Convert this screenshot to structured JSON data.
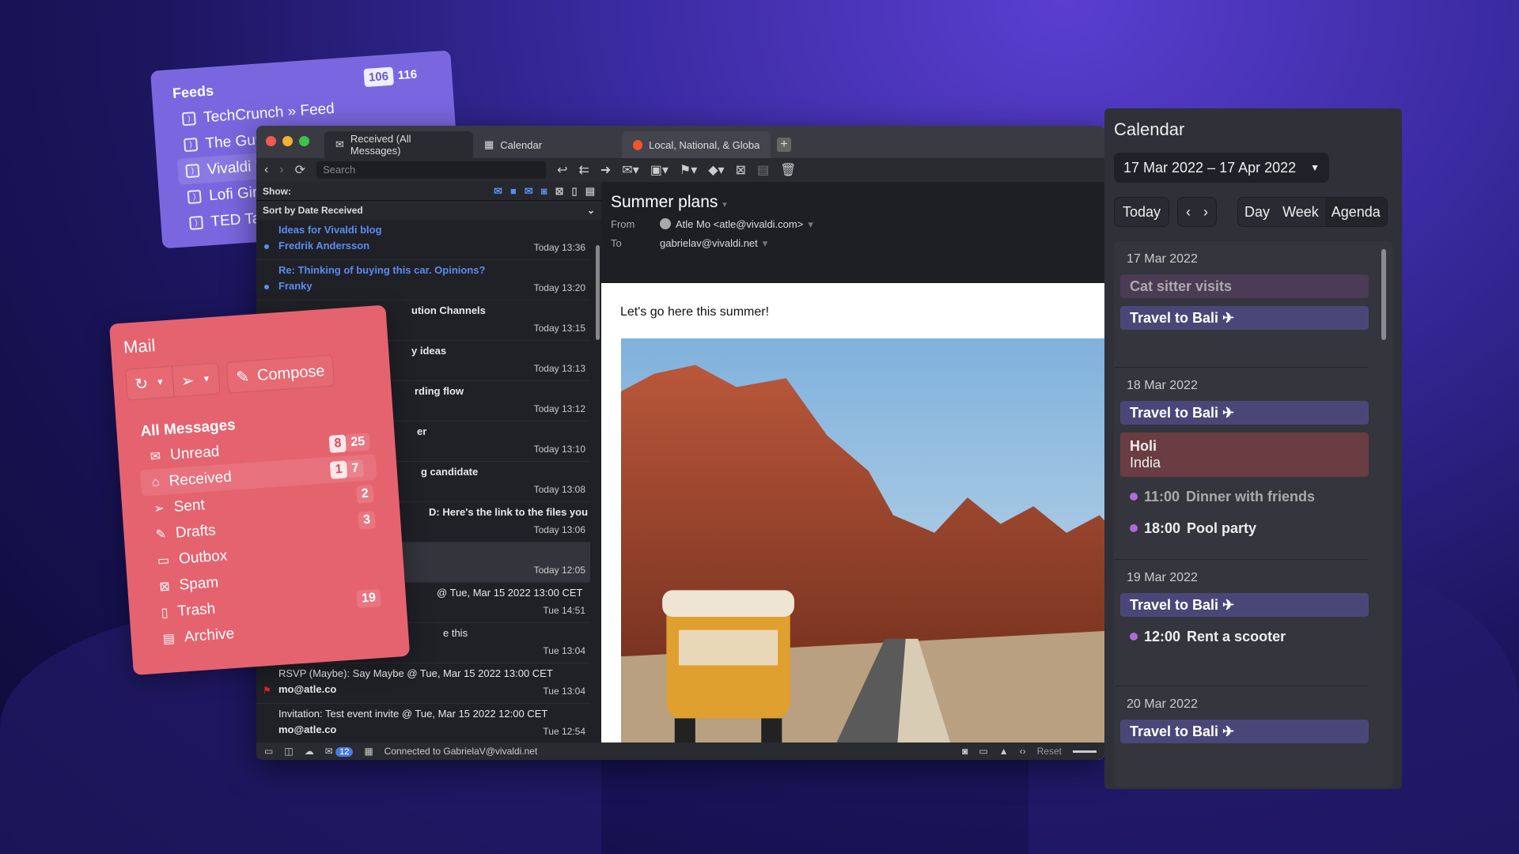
{
  "feeds": {
    "title": "Feeds",
    "badge_unread": "106",
    "badge_total": "116",
    "items": [
      {
        "label": "TechCrunch » Feed"
      },
      {
        "label": "The Gurdi"
      },
      {
        "label": "Vivaldi Br"
      },
      {
        "label": "Lofi Girl"
      },
      {
        "label": "TED Talk"
      }
    ]
  },
  "window": {
    "tabs": [
      {
        "label": "Received (All Messages)",
        "icon": "mail-icon"
      },
      {
        "label": "Calendar",
        "icon": "calendar-icon"
      },
      {
        "label": "Local, National, & Global D",
        "icon": "news-favicon"
      }
    ],
    "new_tab": "+",
    "search_placeholder": "Search"
  },
  "list": {
    "show_label": "Show:",
    "sort_label": "Sort by Date Received",
    "rows": [
      {
        "subject": "Ideas for Vivaldi blog",
        "from": "Fredrik Andersson",
        "time": "Today 13:36",
        "unread": true
      },
      {
        "subject": "Re: Thinking of buying this car. Opinions?",
        "from": "Franky",
        "time": "Today 13:20",
        "unread": true
      },
      {
        "subject": "ution Channels",
        "from": "",
        "time": "Today 13:15"
      },
      {
        "subject": "y ideas",
        "from": "",
        "time": "Today 13:13"
      },
      {
        "subject": "rding flow",
        "from": "",
        "time": "Today 13:12"
      },
      {
        "subject": "er",
        "from": "",
        "time": "Today 13:10"
      },
      {
        "subject": "g candidate",
        "from": "",
        "time": "Today 13:08"
      },
      {
        "subject": "D: Here's the link to the files you needed",
        "from": "",
        "time": "Today 13:06"
      },
      {
        "subject": "",
        "from": "",
        "time": "Today 12:05",
        "selected": true
      },
      {
        "subject": "@ Tue, Mar 15 2022 13:00 CET",
        "from": "",
        "time": "Tue 14:51"
      },
      {
        "subject": "e this",
        "from": "",
        "time": "Tue 13:04"
      },
      {
        "subject": "RSVP (Maybe): Say Maybe @ Tue, Mar 15 2022 13:00 CET",
        "from": "mo@atle.co",
        "time": "Tue 13:04",
        "flagged": true
      },
      {
        "subject": "Invitation: Test event invite @ Tue, Mar 15 2022 12:00 CET",
        "from": "mo@atle.co",
        "time": "Tue 12:54"
      }
    ]
  },
  "message": {
    "subject": "Summer plans",
    "from_label": "From",
    "from": "Atle Mo <atle@vivaldi.com>",
    "to_label": "To",
    "to": "gabrielav@vivaldi.net",
    "body": "Let's go here this summer!"
  },
  "status": {
    "unread_count": "12",
    "connection": "Connected to GabrielaV@vivaldi.net",
    "reset": "Reset"
  },
  "mail": {
    "title": "Mail",
    "compose": "Compose",
    "all_messages": "All Messages",
    "folders": [
      {
        "label": "Unread",
        "hl": "8",
        "count": "25"
      },
      {
        "label": "Received",
        "hl": "1",
        "count": "7"
      },
      {
        "label": "Sent",
        "count": "2"
      },
      {
        "label": "Drafts",
        "count": "3"
      },
      {
        "label": "Outbox"
      },
      {
        "label": "Spam"
      },
      {
        "label": "Trash",
        "count": "19"
      },
      {
        "label": "Archive"
      }
    ]
  },
  "calendar": {
    "title": "Calendar",
    "range": "17 Mar 2022 – 17 Apr 2022",
    "today": "Today",
    "views": [
      "Day",
      "Week",
      "Agenda"
    ],
    "active_view": "Agenda",
    "days": [
      {
        "date": "17 Mar 2022",
        "events": [
          {
            "title": "Cat sitter visits",
            "style": "mauve"
          },
          {
            "title": "Travel to Bali ✈",
            "style": "purple"
          }
        ]
      },
      {
        "date": "18 Mar 2022",
        "events": [
          {
            "title": "Travel to Bali ✈",
            "style": "purple"
          },
          {
            "title": "Holi",
            "sub": "India",
            "style": "red"
          },
          {
            "time": "11:00",
            "title": "Dinner with friends"
          },
          {
            "time": "18:00",
            "title": "Pool party"
          }
        ]
      },
      {
        "date": "19 Mar 2022",
        "events": [
          {
            "title": "Travel to Bali ✈",
            "style": "purple"
          },
          {
            "time": "12:00",
            "title": "Rent a scooter"
          }
        ]
      },
      {
        "date": "20 Mar 2022",
        "events": [
          {
            "title": "Travel to Bali ✈",
            "style": "purple"
          }
        ]
      }
    ]
  },
  "colors": {
    "accent": "#5b8cf0",
    "mail_panel": "#e5636f",
    "feeds_panel": "#7a67e0",
    "flag": "#e2232a"
  }
}
